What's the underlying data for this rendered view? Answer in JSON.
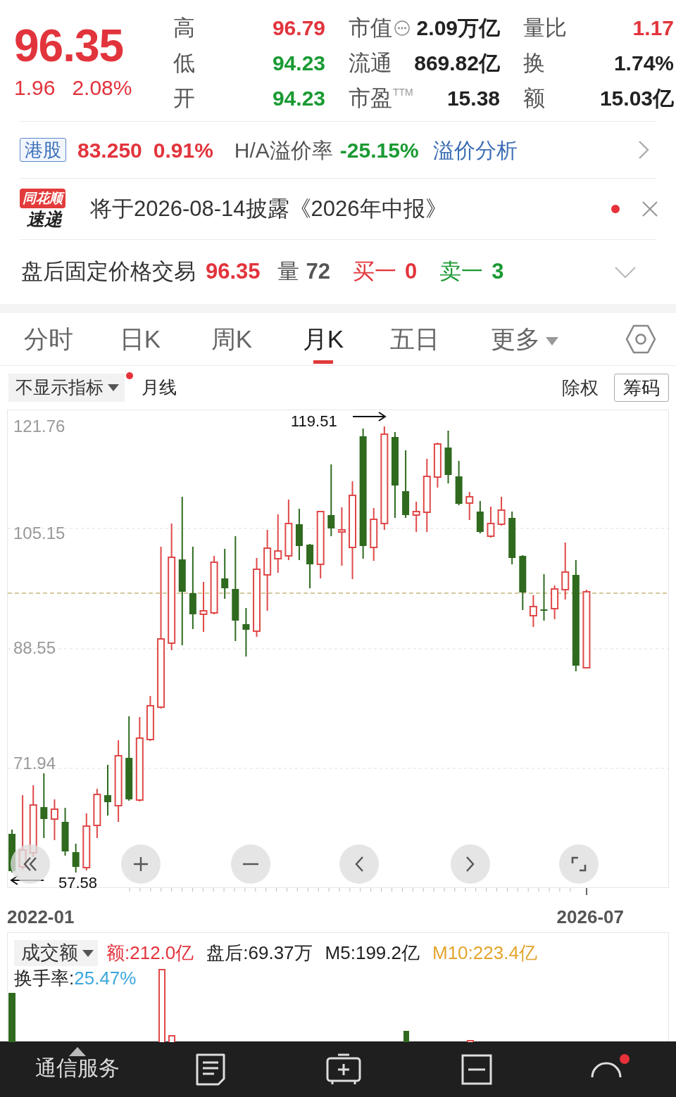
{
  "quote": {
    "price": "96.35",
    "change": "1.96",
    "change_pct": "2.08%",
    "color": "#e2343c"
  },
  "stats": [
    {
      "label": "高",
      "value": "96.79",
      "color": "#e2343c",
      "kind": "plain"
    },
    {
      "label": "市值",
      "value": "2.09万亿",
      "color": "#222222",
      "kind": "info"
    },
    {
      "label": "量比",
      "value": "1.17",
      "color": "#e2343c",
      "kind": "plain"
    },
    {
      "label": "低",
      "value": "94.23",
      "color": "#1a9a33",
      "kind": "plain"
    },
    {
      "label": "流通",
      "value": "869.82亿",
      "color": "#222222",
      "kind": "plain"
    },
    {
      "label": "换",
      "value": "1.74%",
      "color": "#222222",
      "kind": "plain"
    },
    {
      "label": "开",
      "value": "94.23",
      "color": "#1a9a33",
      "kind": "plain"
    },
    {
      "label": "市盈$^{TTM}$",
      "value": "15.38",
      "color": "#222222",
      "kind": "plain"
    },
    {
      "label": "额",
      "value": "15.03亿",
      "color": "#222222",
      "kind": "plain"
    }
  ],
  "hk": {
    "tag": "港股",
    "price": "83.250",
    "change_pct": "0.91%",
    "color": "#e2343c",
    "premium_label": "H/A溢价率",
    "premium": "-25.15%",
    "link": "溢价分析"
  },
  "notice": {
    "logo_top": "同花顺",
    "logo_bottom": "速递",
    "text": "将于2026-08-14披露《2026年中报》",
    "unread": true
  },
  "after_hours": {
    "label": "盘后固定价格交易",
    "price": "96.35",
    "volume_label": "量",
    "volume": "72",
    "bid_label": "买一",
    "bid": "0",
    "ask_label": "卖一",
    "ask": "3",
    "expanded": false
  },
  "tabs": [
    {
      "label": "分时",
      "selected": false,
      "kind": "plain"
    },
    {
      "label": "日K",
      "selected": false,
      "kind": "plain"
    },
    {
      "label": "周K",
      "selected": false,
      "kind": "plain"
    },
    {
      "label": "月K",
      "selected": true,
      "kind": "plain"
    },
    {
      "label": "五日",
      "selected": false,
      "kind": "plain"
    },
    {
      "label": "更多",
      "selected": false,
      "kind": "dropdown"
    }
  ],
  "chart_toolbar": {
    "indicator": "不显示指标",
    "indicator_dot": true,
    "period": "月线",
    "adjust": "除权",
    "chips": "筹码"
  },
  "chart": {
    "y_labels": [
      "121.76",
      "105.15",
      "88.55",
      "71.94"
    ],
    "high_marker": "119.51",
    "low_marker": "57.58",
    "x_labels": [
      "2022-01",
      "2026-07"
    ]
  },
  "volume": {
    "indicator": "成交额",
    "legend": [
      {
        "text": "额:212.0亿",
        "color": "#e2343c"
      },
      {
        "text": "盘后:69.37万",
        "color": "#222222"
      },
      {
        "text": "M5:199.2亿",
        "color": "#222222"
      },
      {
        "text": "M10:223.4亿",
        "color": "#e3a52c"
      }
    ],
    "turnover_label": "换手率:",
    "turnover": "25.47%"
  },
  "bottom_bar": {
    "sector": "通信服务",
    "alert_dot": true
  }
}
